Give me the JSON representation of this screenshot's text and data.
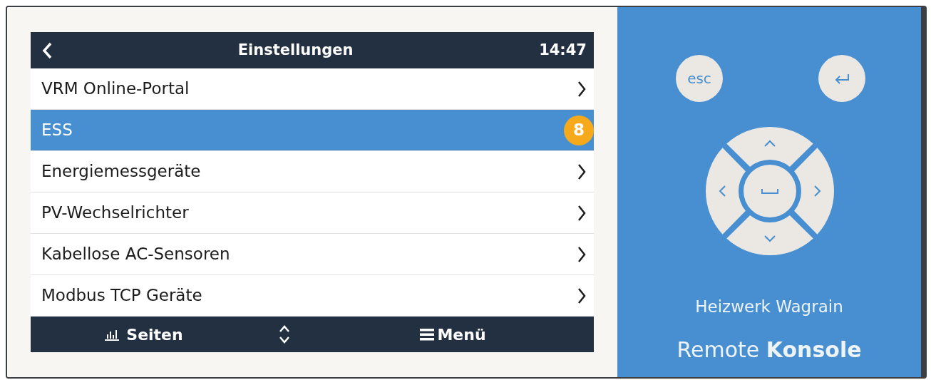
{
  "header": {
    "title": "Einstellungen",
    "time": "14:47"
  },
  "menu_items": [
    {
      "label": "VRM Online-Portal",
      "selected": false
    },
    {
      "label": "ESS",
      "selected": true,
      "marker": "8"
    },
    {
      "label": "Energiemessgeräte",
      "selected": false
    },
    {
      "label": "PV-Wechselrichter",
      "selected": false
    },
    {
      "label": "Kabellose AC-Sensoren",
      "selected": false
    },
    {
      "label": "Modbus TCP Geräte",
      "selected": false
    }
  ],
  "footer": {
    "pages": "Seiten",
    "menu": "Menü"
  },
  "remote": {
    "esc_key": "esc",
    "site_name": "Heizwerk Wagrain",
    "brand": "Remote **Konsole**"
  }
}
